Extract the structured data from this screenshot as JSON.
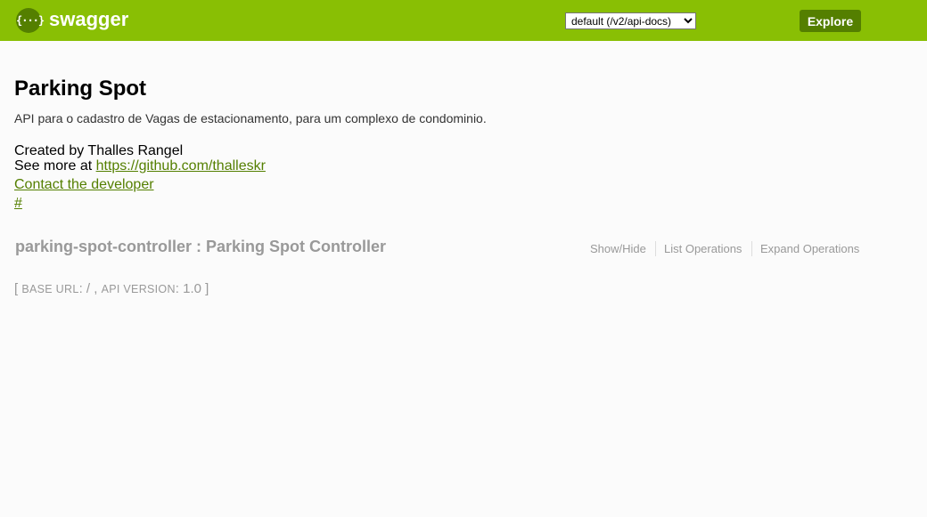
{
  "header": {
    "logo_text": "swagger",
    "spec_select": {
      "selected": "default (/v2/api-docs)",
      "options": [
        "default (/v2/api-docs)"
      ]
    },
    "explore_label": "Explore"
  },
  "info": {
    "title": "Parking Spot",
    "description": "API para o cadastro de Vagas de estacionamento, para um complexo de condominio.",
    "created_by": "Created by Thalles Rangel",
    "see_more_prefix": "See more at ",
    "see_more_link": "https://github.com/thalleskr",
    "contact_link": "Contact the developer",
    "hash_link": "#"
  },
  "resource": {
    "title": "parking-spot-controller : Parking Spot Controller",
    "show_hide": "Show/Hide",
    "list_operations": "List Operations",
    "expand_operations": "Expand Operations"
  },
  "footer": {
    "open_bracket": "[ ",
    "base_url_label": "BASE URL",
    "base_url_value": ": / , ",
    "api_version_label": "API VERSION",
    "api_version_value": ": 1.0 ]"
  },
  "colors": {
    "header_bg": "#89bf04",
    "accent_dark": "#547f00",
    "muted_text": "#999999"
  },
  "icons": {
    "logo": "swagger-braces-icon"
  }
}
